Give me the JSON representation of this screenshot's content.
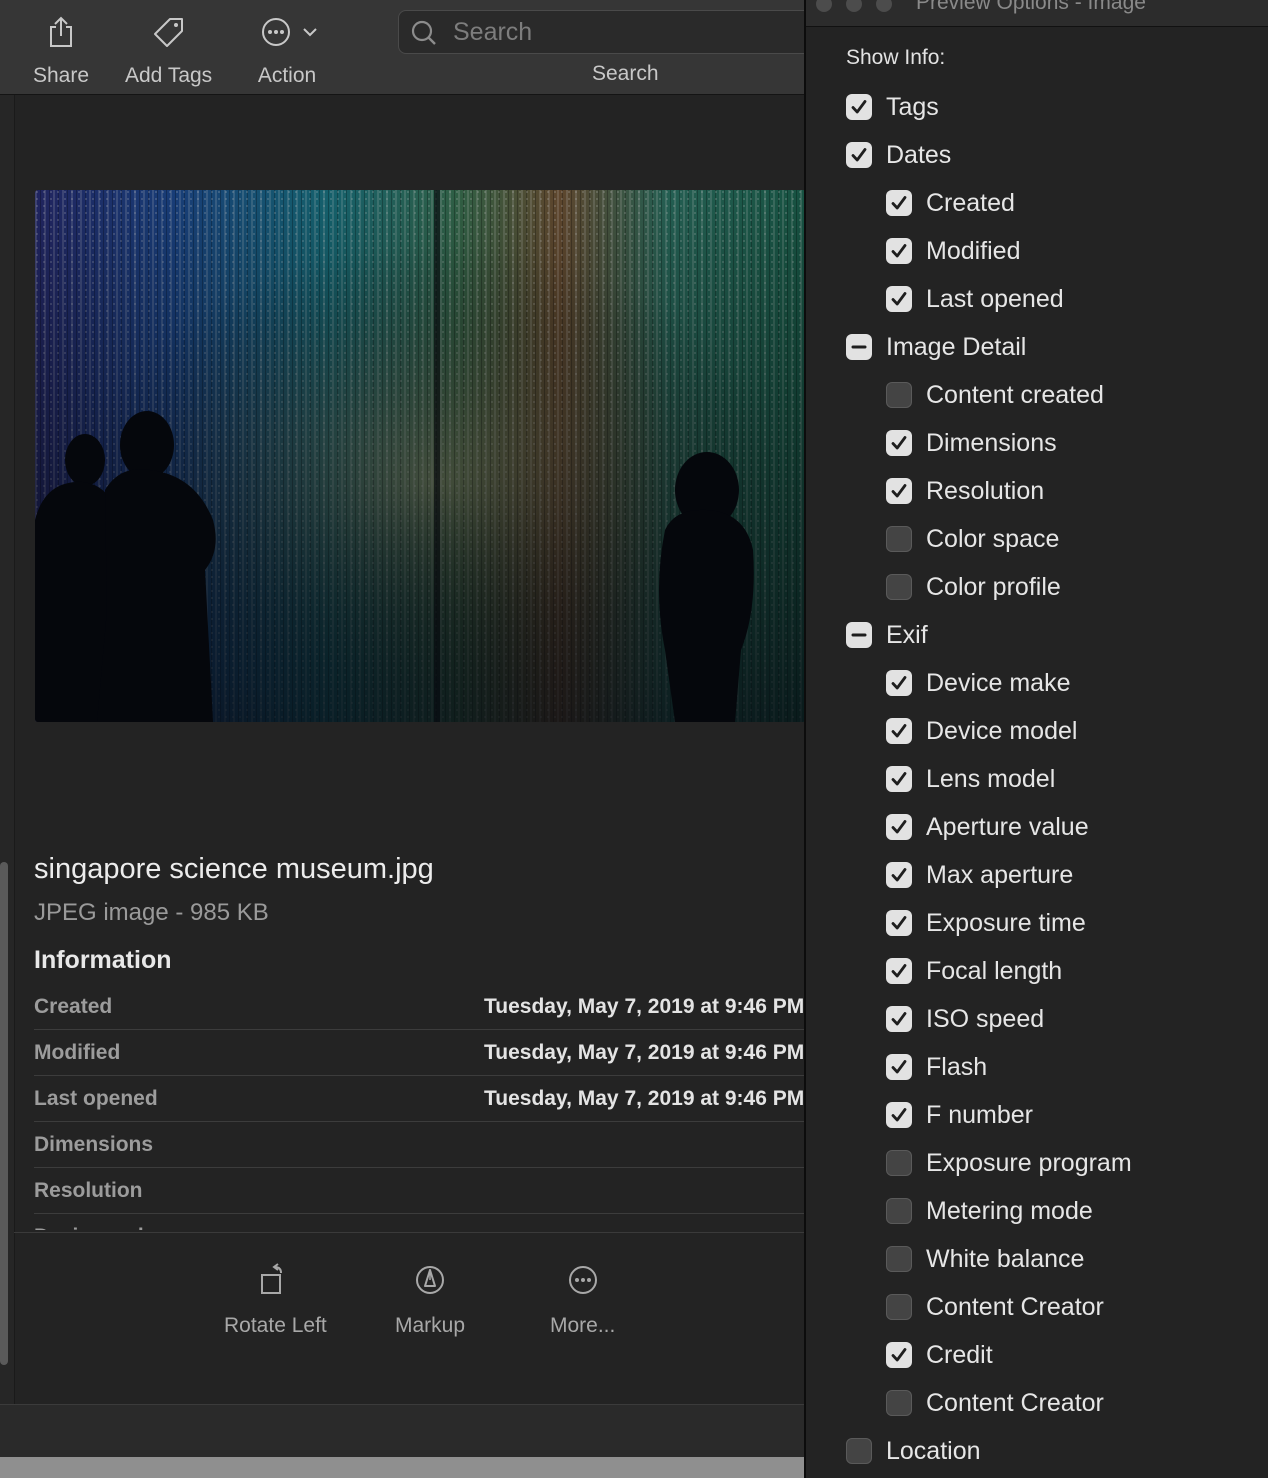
{
  "finder": {
    "toolbar": {
      "share_label": "Share",
      "add_tags_label": "Add Tags",
      "action_label": "Action",
      "search_placeholder": "Search",
      "search_label": "Search"
    },
    "file": {
      "name": "singapore science museum.jpg",
      "kind": "JPEG image - 985 KB"
    },
    "info_heading": "Information",
    "info_rows": [
      {
        "key": "Created",
        "value": "Tuesday, May 7, 2019 at 9:46 PM"
      },
      {
        "key": "Modified",
        "value": "Tuesday, May 7, 2019 at 9:46 PM"
      },
      {
        "key": "Last opened",
        "value": "Tuesday, May 7, 2019 at 9:46 PM"
      },
      {
        "key": "Dimensions",
        "value": ""
      },
      {
        "key": "Resolution",
        "value": ""
      },
      {
        "key": "Device make",
        "value": ""
      }
    ],
    "bottom_actions": {
      "rotate_left": "Rotate Left",
      "markup": "Markup",
      "more": "More..."
    }
  },
  "panel": {
    "title": "Preview Options - Image",
    "show_info_label": "Show Info:",
    "options": [
      {
        "label": "Tags",
        "state": "on",
        "level": 0
      },
      {
        "label": "Dates",
        "state": "on",
        "level": 0
      },
      {
        "label": "Created",
        "state": "on",
        "level": 1
      },
      {
        "label": "Modified",
        "state": "on",
        "level": 1
      },
      {
        "label": "Last opened",
        "state": "on",
        "level": 1
      },
      {
        "label": "Image Detail",
        "state": "mixed",
        "level": 0
      },
      {
        "label": "Content created",
        "state": "off",
        "level": 1
      },
      {
        "label": "Dimensions",
        "state": "on",
        "level": 1
      },
      {
        "label": "Resolution",
        "state": "on",
        "level": 1
      },
      {
        "label": "Color space",
        "state": "off",
        "level": 1
      },
      {
        "label": "Color profile",
        "state": "off",
        "level": 1
      },
      {
        "label": "Exif",
        "state": "mixed",
        "level": 0
      },
      {
        "label": "Device make",
        "state": "on",
        "level": 1
      },
      {
        "label": "Device model",
        "state": "on",
        "level": 1
      },
      {
        "label": "Lens model",
        "state": "on",
        "level": 1
      },
      {
        "label": "Aperture value",
        "state": "on",
        "level": 1
      },
      {
        "label": "Max aperture",
        "state": "on",
        "level": 1
      },
      {
        "label": "Exposure time",
        "state": "on",
        "level": 1
      },
      {
        "label": "Focal length",
        "state": "on",
        "level": 1
      },
      {
        "label": "ISO speed",
        "state": "on",
        "level": 1
      },
      {
        "label": "Flash",
        "state": "on",
        "level": 1
      },
      {
        "label": "F number",
        "state": "on",
        "level": 1
      },
      {
        "label": "Exposure program",
        "state": "off",
        "level": 1
      },
      {
        "label": "Metering mode",
        "state": "off",
        "level": 1
      },
      {
        "label": "White balance",
        "state": "off",
        "level": 1
      },
      {
        "label": "Content Creator",
        "state": "off",
        "level": 1
      },
      {
        "label": "Credit",
        "state": "on",
        "level": 1
      },
      {
        "label": "Content Creator",
        "state": "off",
        "level": 1
      },
      {
        "label": "Location",
        "state": "off",
        "level": 0
      }
    ]
  }
}
